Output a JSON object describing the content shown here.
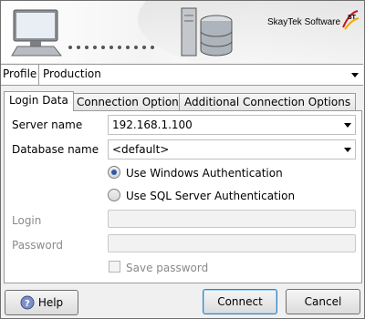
{
  "banner": {
    "brand": "SkayTek Software"
  },
  "profile": {
    "label": "Profile",
    "value": "Production"
  },
  "tabs": [
    {
      "label": "Login Data",
      "active": true
    },
    {
      "label": "Connection Options",
      "active": false
    },
    {
      "label": "Additional Connection Options",
      "active": false
    }
  ],
  "login": {
    "server_label": "Server name",
    "server_value": "192.168.1.100",
    "database_label": "Database name",
    "database_value": "<default>",
    "auth_windows": "Use Windows Authentication",
    "auth_sql": "Use SQL Server Authentication",
    "auth_selected": "windows",
    "login_label": "Login",
    "login_value": "",
    "password_label": "Password",
    "password_value": "",
    "save_password_label": "Save password",
    "save_password_checked": false
  },
  "buttons": {
    "help": "Help",
    "connect": "Connect",
    "cancel": "Cancel"
  },
  "colors": {
    "accent": "#2d5aa8",
    "default_button_border": "#3c7fb1"
  }
}
